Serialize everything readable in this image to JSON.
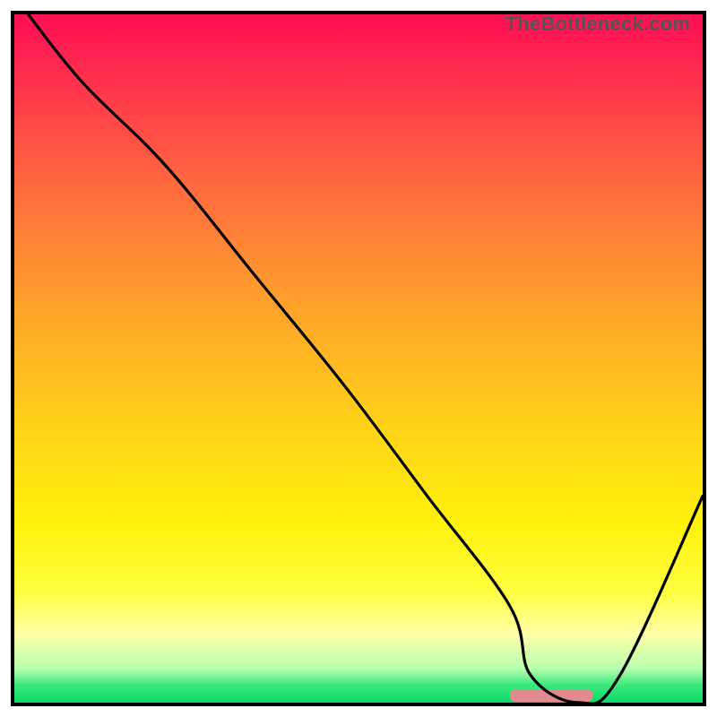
{
  "watermark": "TheBottleneck.com",
  "colors": {
    "frame_border": "#000000",
    "curve": "#000000",
    "marker": "#e38a8f",
    "gradient_top": "#ff1453",
    "gradient_mid": "#ffd716",
    "gradient_bottom": "#0fd86a"
  },
  "chart_data": {
    "type": "line",
    "title": "",
    "xlabel": "",
    "ylabel": "",
    "xlim": [
      0,
      100
    ],
    "ylim": [
      0,
      100
    ],
    "grid": false,
    "legend": false,
    "series": [
      {
        "name": "bottleneck-curve",
        "x": [
          2,
          10,
          22,
          35,
          48,
          60,
          72,
          75,
          82,
          88,
          100
        ],
        "y": [
          100,
          90,
          78,
          62,
          46,
          30,
          14,
          4,
          0,
          4,
          30
        ]
      }
    ],
    "annotations": [
      {
        "name": "optimal-range-marker",
        "shape": "rounded-rect",
        "x_start": 72,
        "x_end": 84,
        "y": 0,
        "color": "#e38a8f"
      }
    ],
    "background_gradient": {
      "orientation": "vertical",
      "stops": [
        {
          "pct": 0,
          "color": "#ff1453"
        },
        {
          "pct": 50,
          "color": "#ffd716"
        },
        {
          "pct": 90,
          "color": "#ffffa8"
        },
        {
          "pct": 100,
          "color": "#0fd86a"
        }
      ]
    }
  }
}
